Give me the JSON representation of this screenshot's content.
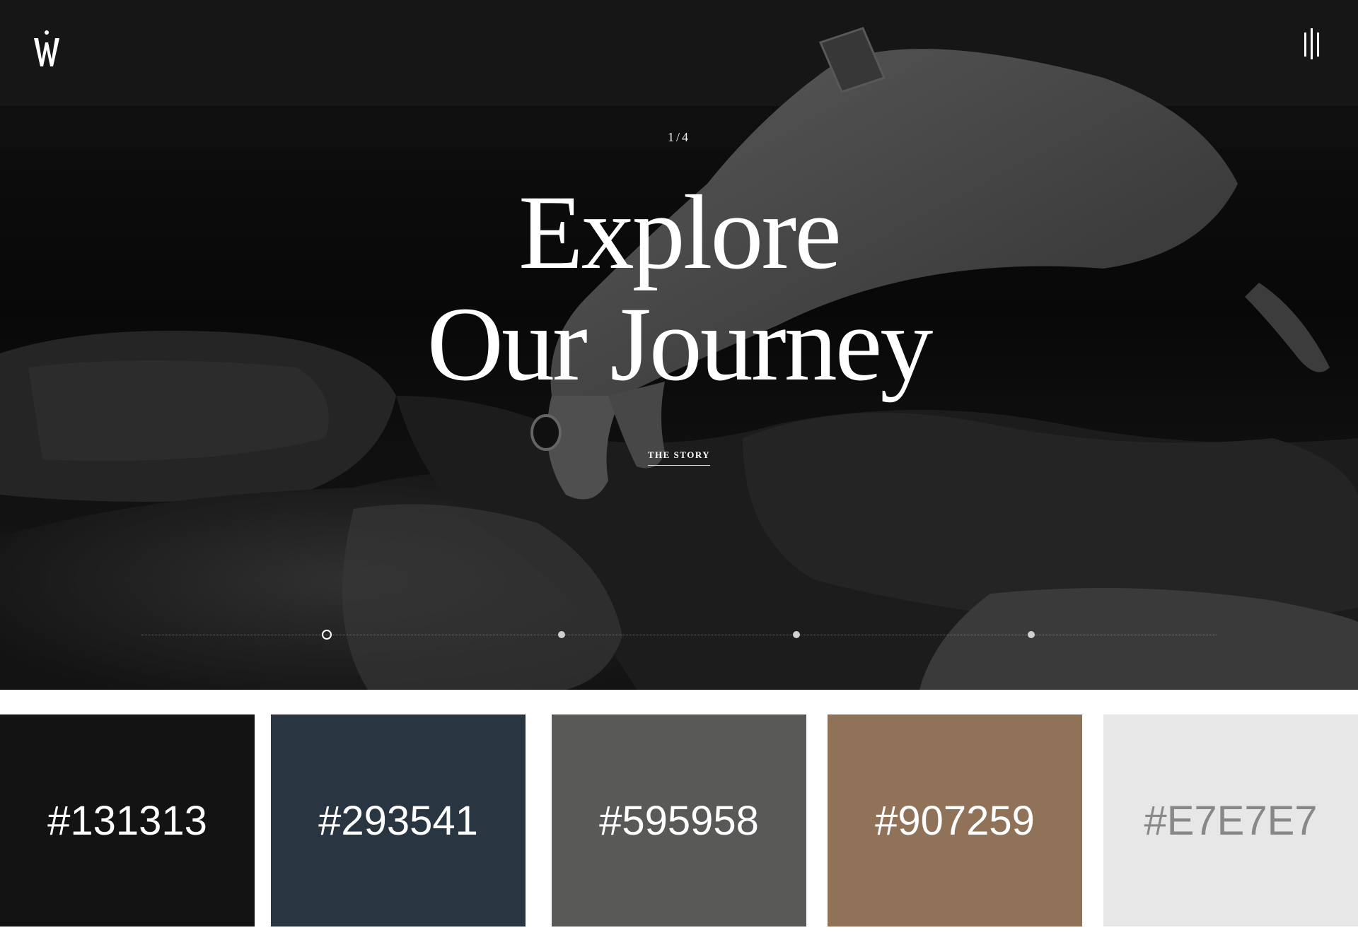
{
  "header": {
    "logo_icon": "w-monogram-logo-icon",
    "menu_icon": "vertical-bars-menu-icon"
  },
  "hero": {
    "slide_counter": "1/4",
    "title_line1": "Explore",
    "title_line2": "Our Journey",
    "cta_label": "THE STORY",
    "timeline": {
      "slide_count": 4,
      "active_index": 0
    }
  },
  "palette": [
    {
      "hex": "#131313",
      "label": "#131313",
      "text_color": "#ffffff"
    },
    {
      "hex": "#293541",
      "label": "#293541",
      "text_color": "#ffffff"
    },
    {
      "hex": "#595958",
      "label": "#595958",
      "text_color": "#ffffff"
    },
    {
      "hex": "#907259",
      "label": "#907259",
      "text_color": "#ffffff"
    },
    {
      "hex": "#E7E7E7",
      "label": "#E7E7E7",
      "text_color": "#888888"
    }
  ]
}
